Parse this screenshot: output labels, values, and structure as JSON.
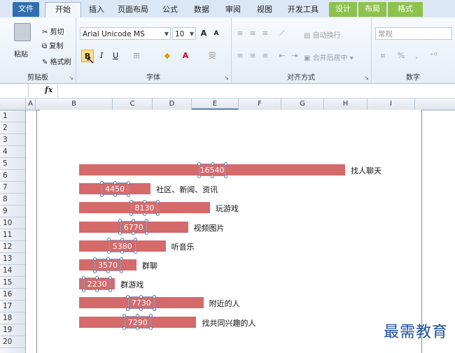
{
  "tabs": [
    "文件",
    "开始",
    "插入",
    "页面布局",
    "公式",
    "数据",
    "审阅",
    "视图",
    "开发工具",
    "设计",
    "布局",
    "格式"
  ],
  "clipboard": {
    "paste": "粘贴",
    "cut": "剪切",
    "copy": "复制",
    "format_painter": "格式刷",
    "label": "剪贴板"
  },
  "font": {
    "name": "Arial Unicode MS",
    "size": "10",
    "label": "字体",
    "bold": "B",
    "italic": "I",
    "underline": "U",
    "grow": "A",
    "shrink": "A",
    "font_color": "A",
    "wen": "雯"
  },
  "alignment": {
    "wrap": "自动换行",
    "merge": "合并后居中",
    "label": "对齐方式"
  },
  "number": {
    "format": "常规",
    "percent": "%",
    "comma": ",",
    "label": "数字"
  },
  "formula_bar": {
    "fx": "fx",
    "value": ""
  },
  "columns": [
    "A",
    "B",
    "C",
    "D",
    "E",
    "F",
    "G",
    "H",
    "I"
  ],
  "rows": [
    "1",
    "2",
    "3",
    "4",
    "5",
    "6",
    "7",
    "8",
    "9",
    "10",
    "11",
    "12",
    "13",
    "14",
    "15",
    "16",
    "17",
    "18",
    "19",
    "20"
  ],
  "chart_data": {
    "type": "bar",
    "categories": [
      "找人聊天",
      "社区、新闻、资讯",
      "玩游戏",
      "视频图片",
      "听音乐",
      "群聊",
      "群游戏",
      "附近的人",
      "找共同兴趣的人"
    ],
    "values": [
      16540,
      4450,
      8130,
      6770,
      5380,
      3570,
      2230,
      7730,
      7290
    ],
    "color": "#d56a6b",
    "xlim": [
      0,
      16540
    ]
  },
  "watermark": "最需教育"
}
